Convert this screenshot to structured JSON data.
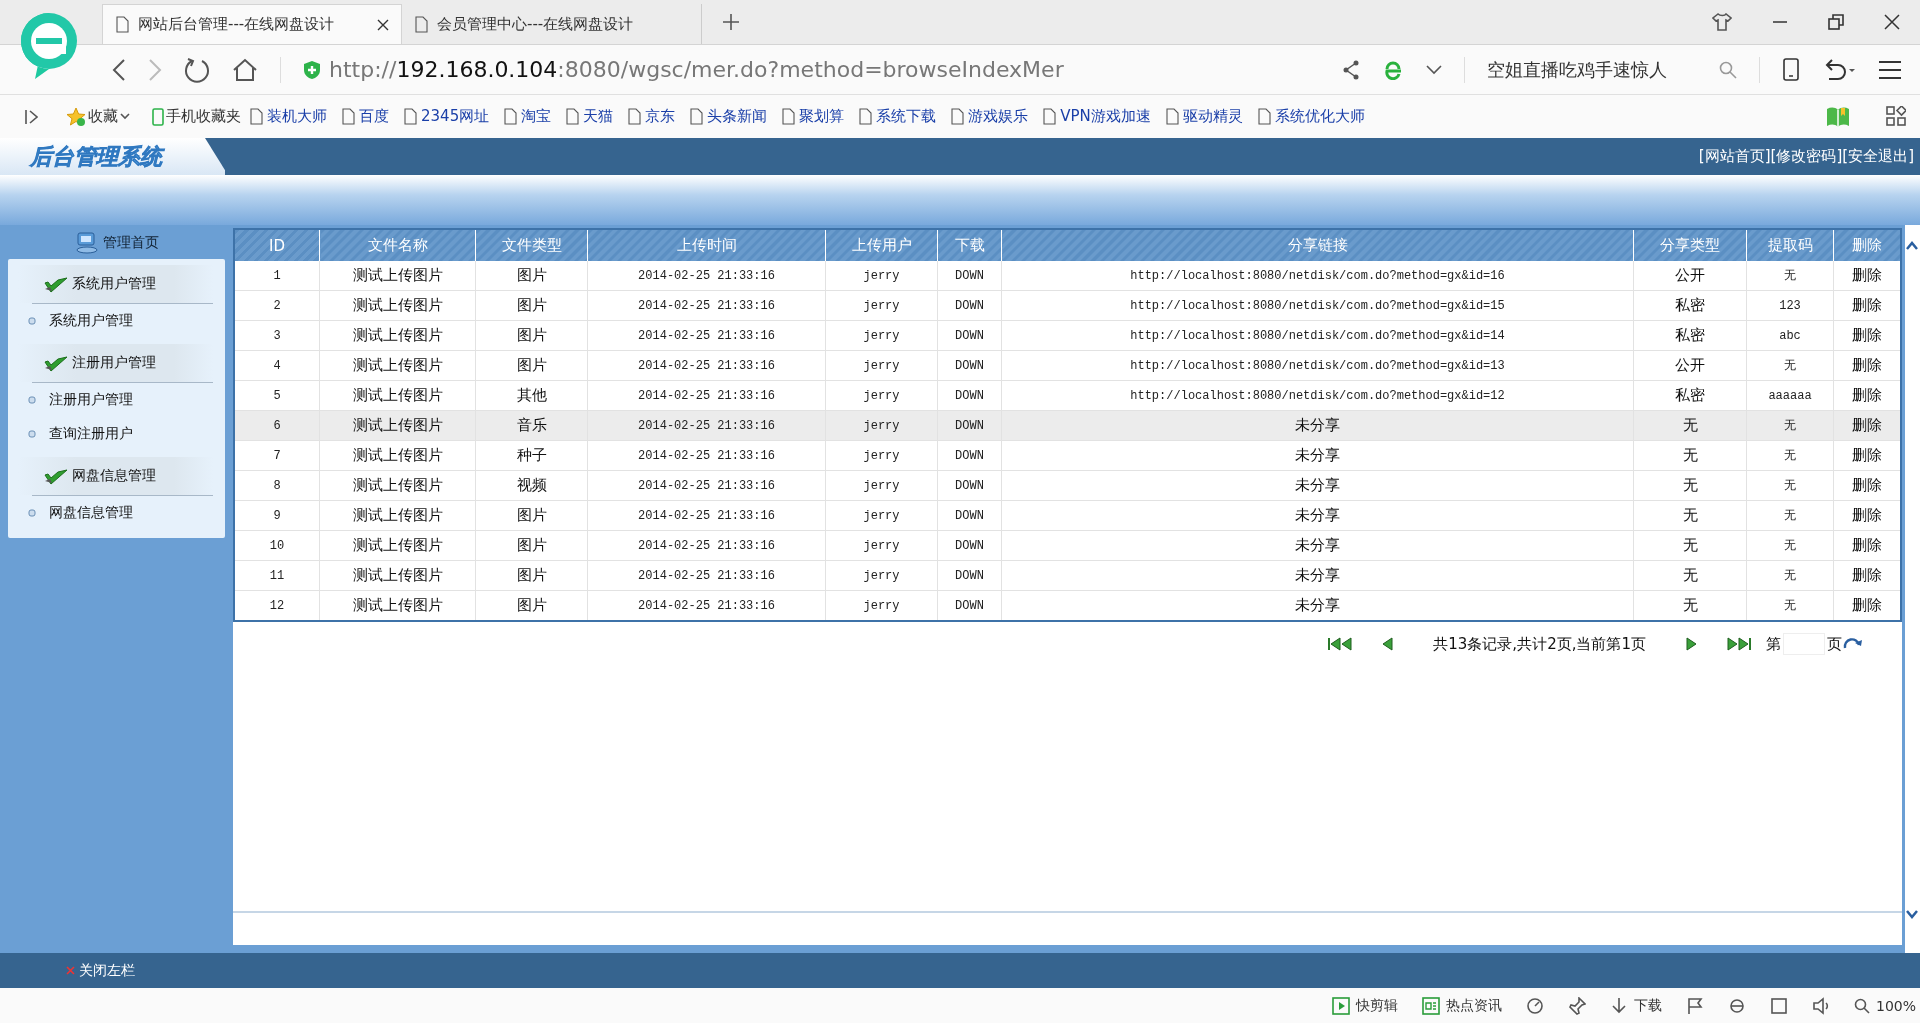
{
  "browser": {
    "tabs": [
      {
        "title": "网站后台管理---在线网盘设计",
        "selected": true
      },
      {
        "title": "会员管理中心---在线网盘设计",
        "selected": false
      }
    ],
    "address": {
      "scheme": "http://",
      "host": "192.168.0.104",
      "rest": ":8080/wgsc/mer.do?method=browseIndexMer"
    },
    "search": {
      "value": "空姐直播吃鸡手速惊人"
    },
    "favorites": {
      "label": "收藏",
      "mobile": "手机收藏夹"
    },
    "bookmarks": [
      "装机大师",
      "百度",
      "2345网址",
      "淘宝",
      "天猫",
      "京东",
      "头条新闻",
      "聚划算",
      "系统下载",
      "游戏娱乐",
      "VPN游戏加速",
      "驱动精灵",
      "系统优化大师"
    ]
  },
  "site": {
    "logo": "后台管理系统",
    "header_links": [
      "[网站首页]",
      "[修改密码]",
      "[安全退出]"
    ],
    "sidebar": {
      "home": "管理首页",
      "groups": [
        {
          "title": "系统用户管理",
          "items": [
            "系统用户管理"
          ]
        },
        {
          "title": "注册用户管理",
          "items": [
            "注册用户管理",
            "查询注册用户"
          ]
        },
        {
          "title": "网盘信息管理",
          "items": [
            "网盘信息管理"
          ]
        }
      ]
    },
    "close_sidebar": "关闭左栏"
  },
  "table": {
    "columns": [
      "ID",
      "文件名称",
      "文件类型",
      "上传时间",
      "上传用户",
      "下载",
      "分享链接",
      "分享类型",
      "提取码",
      "删除"
    ],
    "rows": [
      {
        "id": "1",
        "name": "测试上传图片",
        "type": "图片",
        "time": "2014-02-25 21:33:16",
        "user": "jerry",
        "download": "DOWN",
        "link": "http://localhost:8080/netdisk/com.do?method=gx&id=16",
        "share_type": "公开",
        "code": "无",
        "delete": "删除",
        "selected": false
      },
      {
        "id": "2",
        "name": "测试上传图片",
        "type": "图片",
        "time": "2014-02-25 21:33:16",
        "user": "jerry",
        "download": "DOWN",
        "link": "http://localhost:8080/netdisk/com.do?method=gx&id=15",
        "share_type": "私密",
        "code": "123",
        "delete": "删除",
        "selected": false
      },
      {
        "id": "3",
        "name": "测试上传图片",
        "type": "图片",
        "time": "2014-02-25 21:33:16",
        "user": "jerry",
        "download": "DOWN",
        "link": "http://localhost:8080/netdisk/com.do?method=gx&id=14",
        "share_type": "私密",
        "code": "abc",
        "delete": "删除",
        "selected": false
      },
      {
        "id": "4",
        "name": "测试上传图片",
        "type": "图片",
        "time": "2014-02-25 21:33:16",
        "user": "jerry",
        "download": "DOWN",
        "link": "http://localhost:8080/netdisk/com.do?method=gx&id=13",
        "share_type": "公开",
        "code": "无",
        "delete": "删除",
        "selected": false
      },
      {
        "id": "5",
        "name": "测试上传图片",
        "type": "其他",
        "time": "2014-02-25 21:33:16",
        "user": "jerry",
        "download": "DOWN",
        "link": "http://localhost:8080/netdisk/com.do?method=gx&id=12",
        "share_type": "私密",
        "code": "aaaaaa",
        "delete": "删除",
        "selected": false
      },
      {
        "id": "6",
        "name": "测试上传图片",
        "type": "音乐",
        "time": "2014-02-25 21:33:16",
        "user": "jerry",
        "download": "DOWN",
        "link": "未分享",
        "share_type": "无",
        "code": "无",
        "delete": "删除",
        "selected": true
      },
      {
        "id": "7",
        "name": "测试上传图片",
        "type": "种子",
        "time": "2014-02-25 21:33:16",
        "user": "jerry",
        "download": "DOWN",
        "link": "未分享",
        "share_type": "无",
        "code": "无",
        "delete": "删除",
        "selected": false
      },
      {
        "id": "8",
        "name": "测试上传图片",
        "type": "视频",
        "time": "2014-02-25 21:33:16",
        "user": "jerry",
        "download": "DOWN",
        "link": "未分享",
        "share_type": "无",
        "code": "无",
        "delete": "删除",
        "selected": false
      },
      {
        "id": "9",
        "name": "测试上传图片",
        "type": "图片",
        "time": "2014-02-25 21:33:16",
        "user": "jerry",
        "download": "DOWN",
        "link": "未分享",
        "share_type": "无",
        "code": "无",
        "delete": "删除",
        "selected": false
      },
      {
        "id": "10",
        "name": "测试上传图片",
        "type": "图片",
        "time": "2014-02-25 21:33:16",
        "user": "jerry",
        "download": "DOWN",
        "link": "未分享",
        "share_type": "无",
        "code": "无",
        "delete": "删除",
        "selected": false
      },
      {
        "id": "11",
        "name": "测试上传图片",
        "type": "图片",
        "time": "2014-02-25 21:33:16",
        "user": "jerry",
        "download": "DOWN",
        "link": "未分享",
        "share_type": "无",
        "code": "无",
        "delete": "删除",
        "selected": false
      },
      {
        "id": "12",
        "name": "测试上传图片",
        "type": "图片",
        "time": "2014-02-25 21:33:16",
        "user": "jerry",
        "download": "DOWN",
        "link": "未分享",
        "share_type": "无",
        "code": "无",
        "delete": "删除",
        "selected": false
      }
    ]
  },
  "pagination": {
    "summary": "共13条记录,共计2页,当前第1页",
    "page_prefix": "第",
    "page_suffix": "页"
  },
  "status_bar": {
    "items": [
      "快剪辑",
      "热点资讯",
      "下载"
    ],
    "zoom": "100%"
  }
}
